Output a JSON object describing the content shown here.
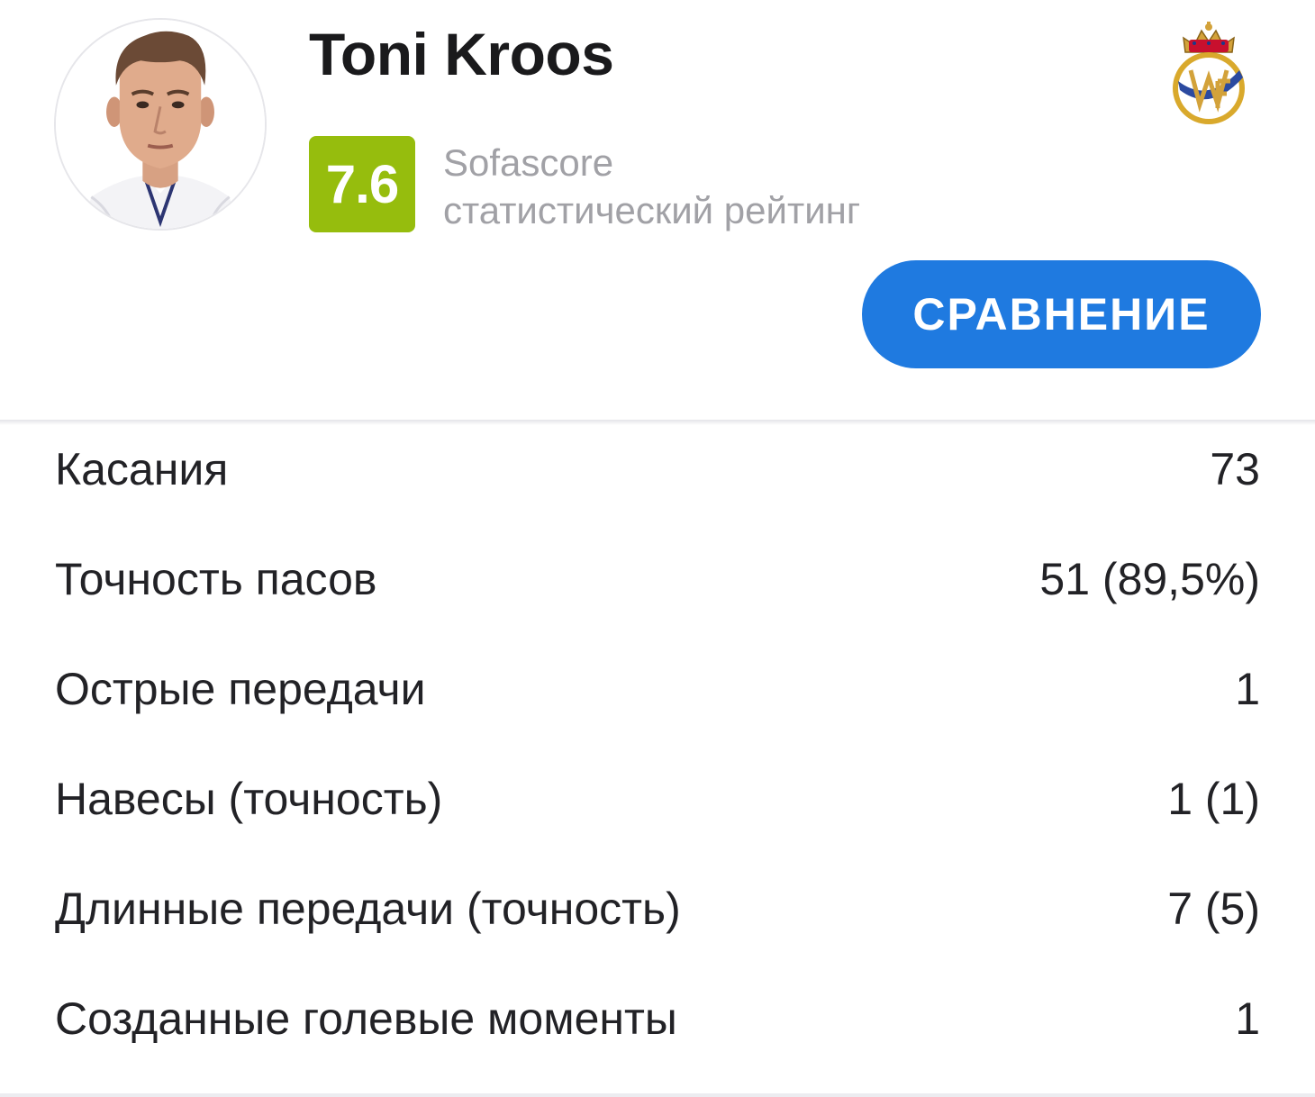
{
  "player": {
    "name": "Toni Kroos",
    "rating": "7.6",
    "rating_source_line1": "Sofascore",
    "rating_source_line2": "статистический рейтинг",
    "rating_color": "#96bd0d"
  },
  "header": {
    "club_logo_icon": "real-madrid-crest-icon",
    "compare_label": "СРАВНЕНИЕ",
    "compare_color": "#1f7ae0"
  },
  "stats": [
    {
      "label": "Касания",
      "value": "73"
    },
    {
      "label": "Точность пасов",
      "value": "51 (89,5%)"
    },
    {
      "label": "Острые передачи",
      "value": "1"
    },
    {
      "label": "Навесы (точность)",
      "value": "1 (1)"
    },
    {
      "label": "Длинные передачи (точность)",
      "value": "7 (5)"
    },
    {
      "label": "Созданные голевые моменты",
      "value": "1"
    }
  ]
}
